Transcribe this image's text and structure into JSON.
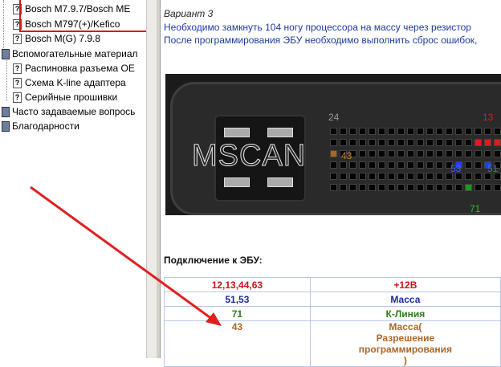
{
  "tree": {
    "items": [
      {
        "label": "Bosch M7.9.7/Bosch ME",
        "kind": "topic"
      },
      {
        "label": "Bosch M797(+)/Kefico",
        "kind": "topic"
      },
      {
        "label": "Bosch M(G) 7.9.8",
        "kind": "topic"
      },
      {
        "label": "Вспомогательные материал",
        "kind": "book"
      },
      {
        "label": "Распиновка разъема OE",
        "kind": "topic"
      },
      {
        "label": "Схема K-line адаптера",
        "kind": "topic"
      },
      {
        "label": "Серийные прошивки",
        "kind": "topic"
      },
      {
        "label": "Часто задаваемые вопрось",
        "kind": "book"
      },
      {
        "label": "Благодарности",
        "kind": "book"
      }
    ]
  },
  "content": {
    "variant": "Вариант 3",
    "instruction_1": "Необходимо замкнуть 104 ногу процессора на массу через резистор",
    "instruction_2": "После программирования ЭБУ необходимо выполнить сброс ошибок,",
    "photo": {
      "watermark": "MSCAN",
      "pin_labels": {
        "p24": "24",
        "p13": "13",
        "p43": "43",
        "p53": "53",
        "p51": "51",
        "p71": "71"
      }
    },
    "section_title": "Подключение к ЭБУ:",
    "table": [
      {
        "pins": "12,13,44,63",
        "signal": "+12В",
        "color": "#c8151b"
      },
      {
        "pins": "51,53",
        "signal": "Масса",
        "color": "#1a2a9a"
      },
      {
        "pins": "71",
        "signal": "К-Линия",
        "color": "#2e7a1e"
      },
      {
        "pins": "43",
        "signal": "Масса( Разрешение программирования )",
        "color": "#a8672a"
      }
    ]
  },
  "colors": {
    "annotation_red": "#d81414",
    "link_blue": "#1e3aa0"
  }
}
